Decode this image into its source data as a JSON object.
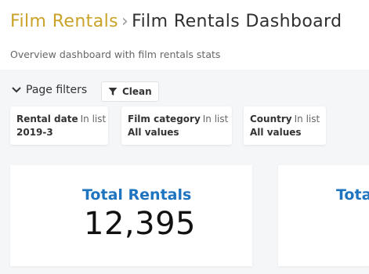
{
  "breadcrumb": {
    "parent": "Film Rentals",
    "separator": "›",
    "current": "Film Rentals Dashboard"
  },
  "subtitle": "Overview dashboard with film rentals stats",
  "filters": {
    "toggle_label": "Page filters",
    "clean_label": "Clean",
    "items": [
      {
        "name": "Rental date",
        "operator": "In list",
        "value": "2019-3"
      },
      {
        "name": "Film category",
        "operator": "In list",
        "value": "All values"
      },
      {
        "name": "Country",
        "operator": "In list",
        "value": "All values"
      }
    ]
  },
  "kpis": [
    {
      "title": "Total Rentals",
      "value": "12,395"
    },
    {
      "title": "Tota",
      "value": ""
    }
  ],
  "colors": {
    "breadcrumb_link": "#c9a227",
    "kpi_title": "#1f74c0",
    "background": "#f5f6f8"
  },
  "icons": {
    "toggle": "chevron-down-icon",
    "clean": "filter-icon"
  }
}
